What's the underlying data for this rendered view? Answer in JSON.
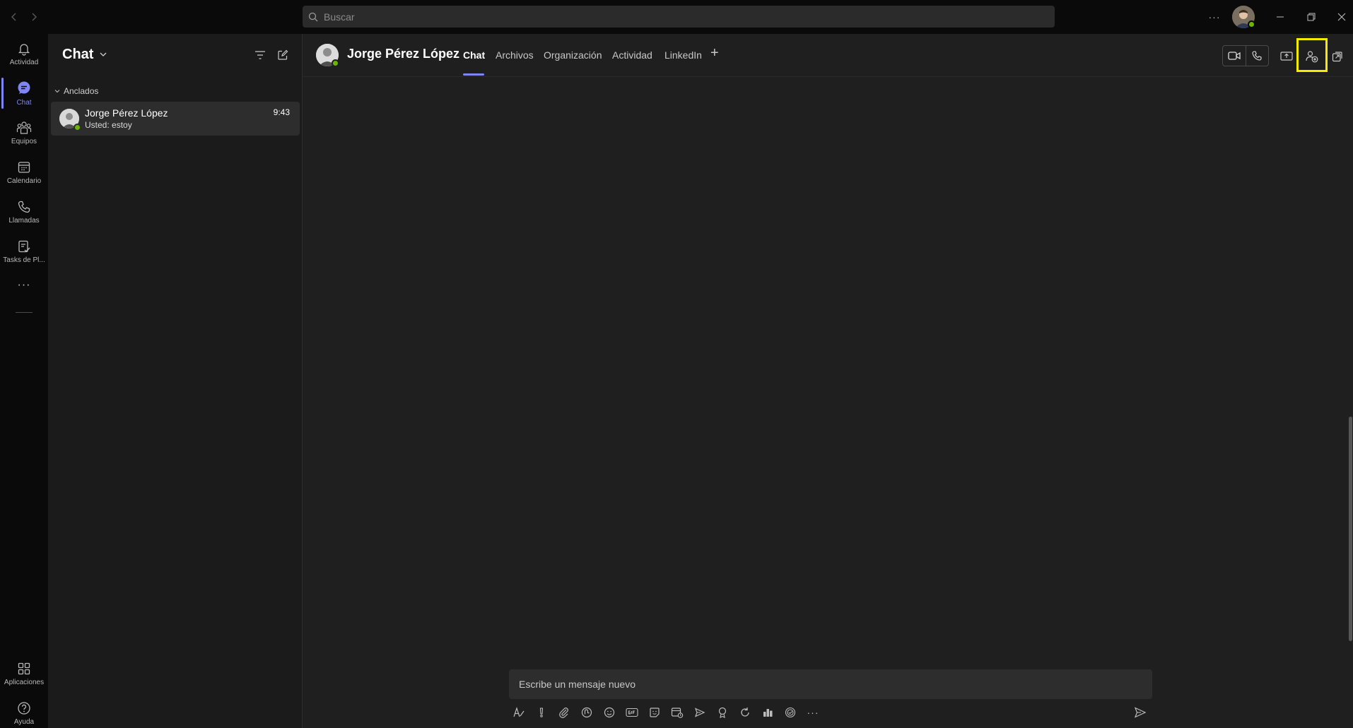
{
  "window": {
    "search_placeholder": "Buscar",
    "more_label": "···"
  },
  "rail": {
    "items": [
      {
        "label": "Actividad",
        "icon": "bell-icon"
      },
      {
        "label": "Chat",
        "icon": "chat-icon",
        "active": true
      },
      {
        "label": "Equipos",
        "icon": "teams-icon"
      },
      {
        "label": "Calendario",
        "icon": "calendar-icon"
      },
      {
        "label": "Llamadas",
        "icon": "phone-icon"
      },
      {
        "label": "Tasks de Pl...",
        "icon": "tasks-icon"
      }
    ],
    "more": "···",
    "bottom": [
      {
        "label": "Aplicaciones",
        "icon": "apps-icon"
      },
      {
        "label": "Ayuda",
        "icon": "help-icon"
      }
    ]
  },
  "chat_list": {
    "title": "Chat",
    "pinned_header": "Anclados",
    "items": [
      {
        "name": "Jorge Pérez López",
        "preview": "Usted: estoy",
        "time": "9:43",
        "presence": "available"
      }
    ]
  },
  "conversation": {
    "contact_name": "Jorge Pérez López",
    "tabs": [
      {
        "label": "Chat",
        "active": true
      },
      {
        "label": "Archivos"
      },
      {
        "label": "Organización"
      },
      {
        "label": "Actividad"
      },
      {
        "label": "LinkedIn"
      }
    ],
    "add_tab": "+",
    "compose_placeholder": "Escribe un mensaje nuevo",
    "toolbar_more": "···"
  },
  "colors": {
    "accent": "#7f85f5",
    "presence_available": "#6bb700",
    "highlight": "#f5ec00"
  }
}
